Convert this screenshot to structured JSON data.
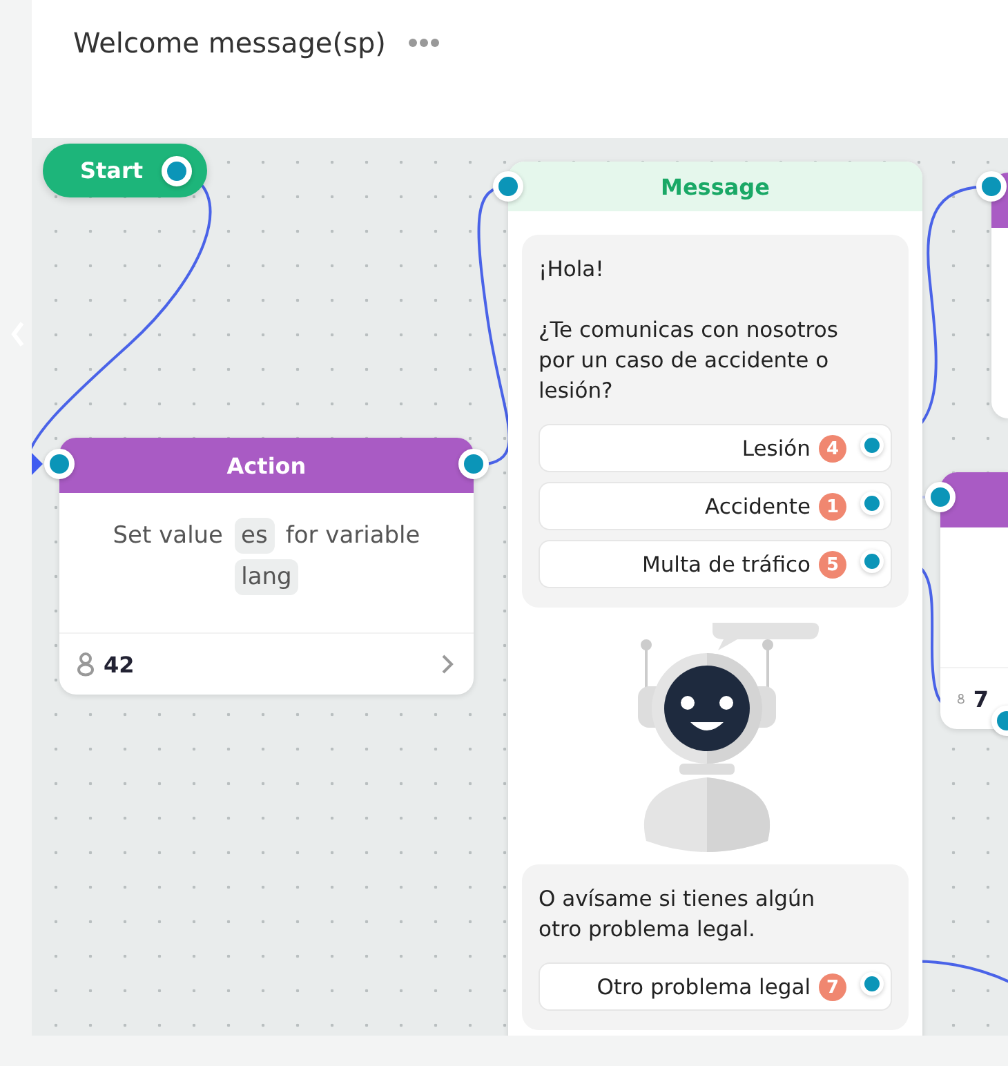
{
  "title": "Welcome message(sp)",
  "start": {
    "label": "Start"
  },
  "action": {
    "title": "Action",
    "parts": [
      {
        "kind": "text",
        "text": "Set value"
      },
      {
        "kind": "chip",
        "text": "es"
      },
      {
        "kind": "text",
        "text": "for variable"
      },
      {
        "kind": "chip",
        "text": "lang"
      }
    ],
    "count": "42"
  },
  "message": {
    "title": "Message",
    "bubbles": [
      {
        "kind": "text",
        "text": "¡Hola!\n\n¿Te comunicas con nosotros por un caso de accidente o lesión?",
        "buttons": [
          {
            "label": "Lesión",
            "badge": "4"
          },
          {
            "label": "Accidente",
            "badge": "1"
          },
          {
            "label": "Multa de tráfico",
            "badge": "5"
          }
        ]
      },
      {
        "kind": "image"
      },
      {
        "kind": "text",
        "text": "O avísame si tienes algún otro problema legal.",
        "buttons": [
          {
            "label": "Otro problema legal",
            "badge": "7"
          }
        ]
      }
    ]
  },
  "side_node": {
    "count": "7"
  }
}
